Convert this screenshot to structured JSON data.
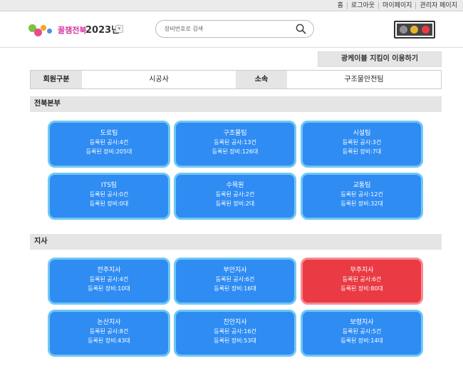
{
  "topnav": [
    {
      "label": "홈"
    },
    {
      "label": "로그아웃"
    },
    {
      "label": "마이페이지"
    },
    {
      "label": "관리자 페이지"
    }
  ],
  "logo": {
    "brand": "꿀잼전북",
    "year": "2023년"
  },
  "search": {
    "placeholder": "장비번호로 검색"
  },
  "colors": {
    "card_blue": "#2f8cf3",
    "card_border": "#6ec8f2",
    "card_alert": "#ea3a43",
    "traffic_lights": [
      "#8e9095",
      "#e3b52a",
      "#ea3a43"
    ]
  },
  "fiber_button": "광케이블 지킴이 이용하기",
  "info": {
    "member_type_label": "회원구분",
    "member_type_value": "시공사",
    "affiliation_label": "소속",
    "affiliation_value": "구조물안전팀"
  },
  "sections": [
    {
      "title": "전북본부",
      "teams": [
        {
          "name": "도로팀",
          "projects": "등록된 공사:4건",
          "equipment": "등록된 장비:205대",
          "alert": false
        },
        {
          "name": "구조물팀",
          "projects": "등록된 공사:13건",
          "equipment": "등록된 장비:126대",
          "alert": false
        },
        {
          "name": "시설팀",
          "projects": "등록된 공사:3건",
          "equipment": "등록된 장비:7대",
          "alert": false
        },
        {
          "name": "ITS팀",
          "projects": "등록된 공사:0건",
          "equipment": "등록된 장비:0대",
          "alert": false
        },
        {
          "name": "수목원",
          "projects": "등록된 공사:2건",
          "equipment": "등록된 장비:2대",
          "alert": false
        },
        {
          "name": "교통팀",
          "projects": "등록된 공사:12건",
          "equipment": "등록된 장비:32대",
          "alert": false
        }
      ]
    },
    {
      "title": "지사",
      "teams": [
        {
          "name": "전주지사",
          "projects": "등록된 공사:4건",
          "equipment": "등록된 장비:10대",
          "alert": false
        },
        {
          "name": "부안지사",
          "projects": "등록된 공사:6건",
          "equipment": "등록된 장비:16대",
          "alert": false
        },
        {
          "name": "무주지사",
          "projects": "등록된 공사:6건",
          "equipment": "등록된 장비:80대",
          "alert": true
        },
        {
          "name": "논산지사",
          "projects": "등록된 공사:8건",
          "equipment": "등록된 장비:43대",
          "alert": false
        },
        {
          "name": "진안지사",
          "projects": "등록된 공사:16건",
          "equipment": "등록된 장비:53대",
          "alert": false
        },
        {
          "name": "보령지사",
          "projects": "등록된 공사:5건",
          "equipment": "등록된 장비:14대",
          "alert": false
        }
      ]
    }
  ]
}
